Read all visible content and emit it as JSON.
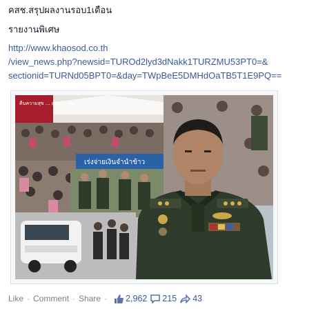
{
  "post": {
    "title_line": "คสช.สรุปผลงานรอบ1เดือน",
    "subtitle_line": "รายงานพิเศษ",
    "link_lines": [
      "http://www.khaosod.co.th",
      "/view_news.php?newsid=TUROd2lyd3dNakk1TURZMU53PT0=&",
      "sectionid=TURNd05BPT0=&day=TWpBeE5DMHdOaTB5T1E9PQ=="
    ]
  },
  "photo": {
    "banner_text": "เร่งจ่ายเงินจำนำข้าว",
    "top_text": "คืนความสุข ... สู่ประชาชน",
    "colors": {
      "uniform": "#2f3b2a",
      "sky": "#c9d6de",
      "crowd": "#6b5e58",
      "banner": "#2a62a8"
    }
  },
  "actions": {
    "like_label": "Like",
    "comment_label": "Comment",
    "share_label": "Share",
    "likes_count": "2,962",
    "comments_count": "215",
    "shares_count": "43",
    "separator": "·"
  },
  "colors": {
    "link": "#3b5998",
    "muted": "#9197a3"
  }
}
